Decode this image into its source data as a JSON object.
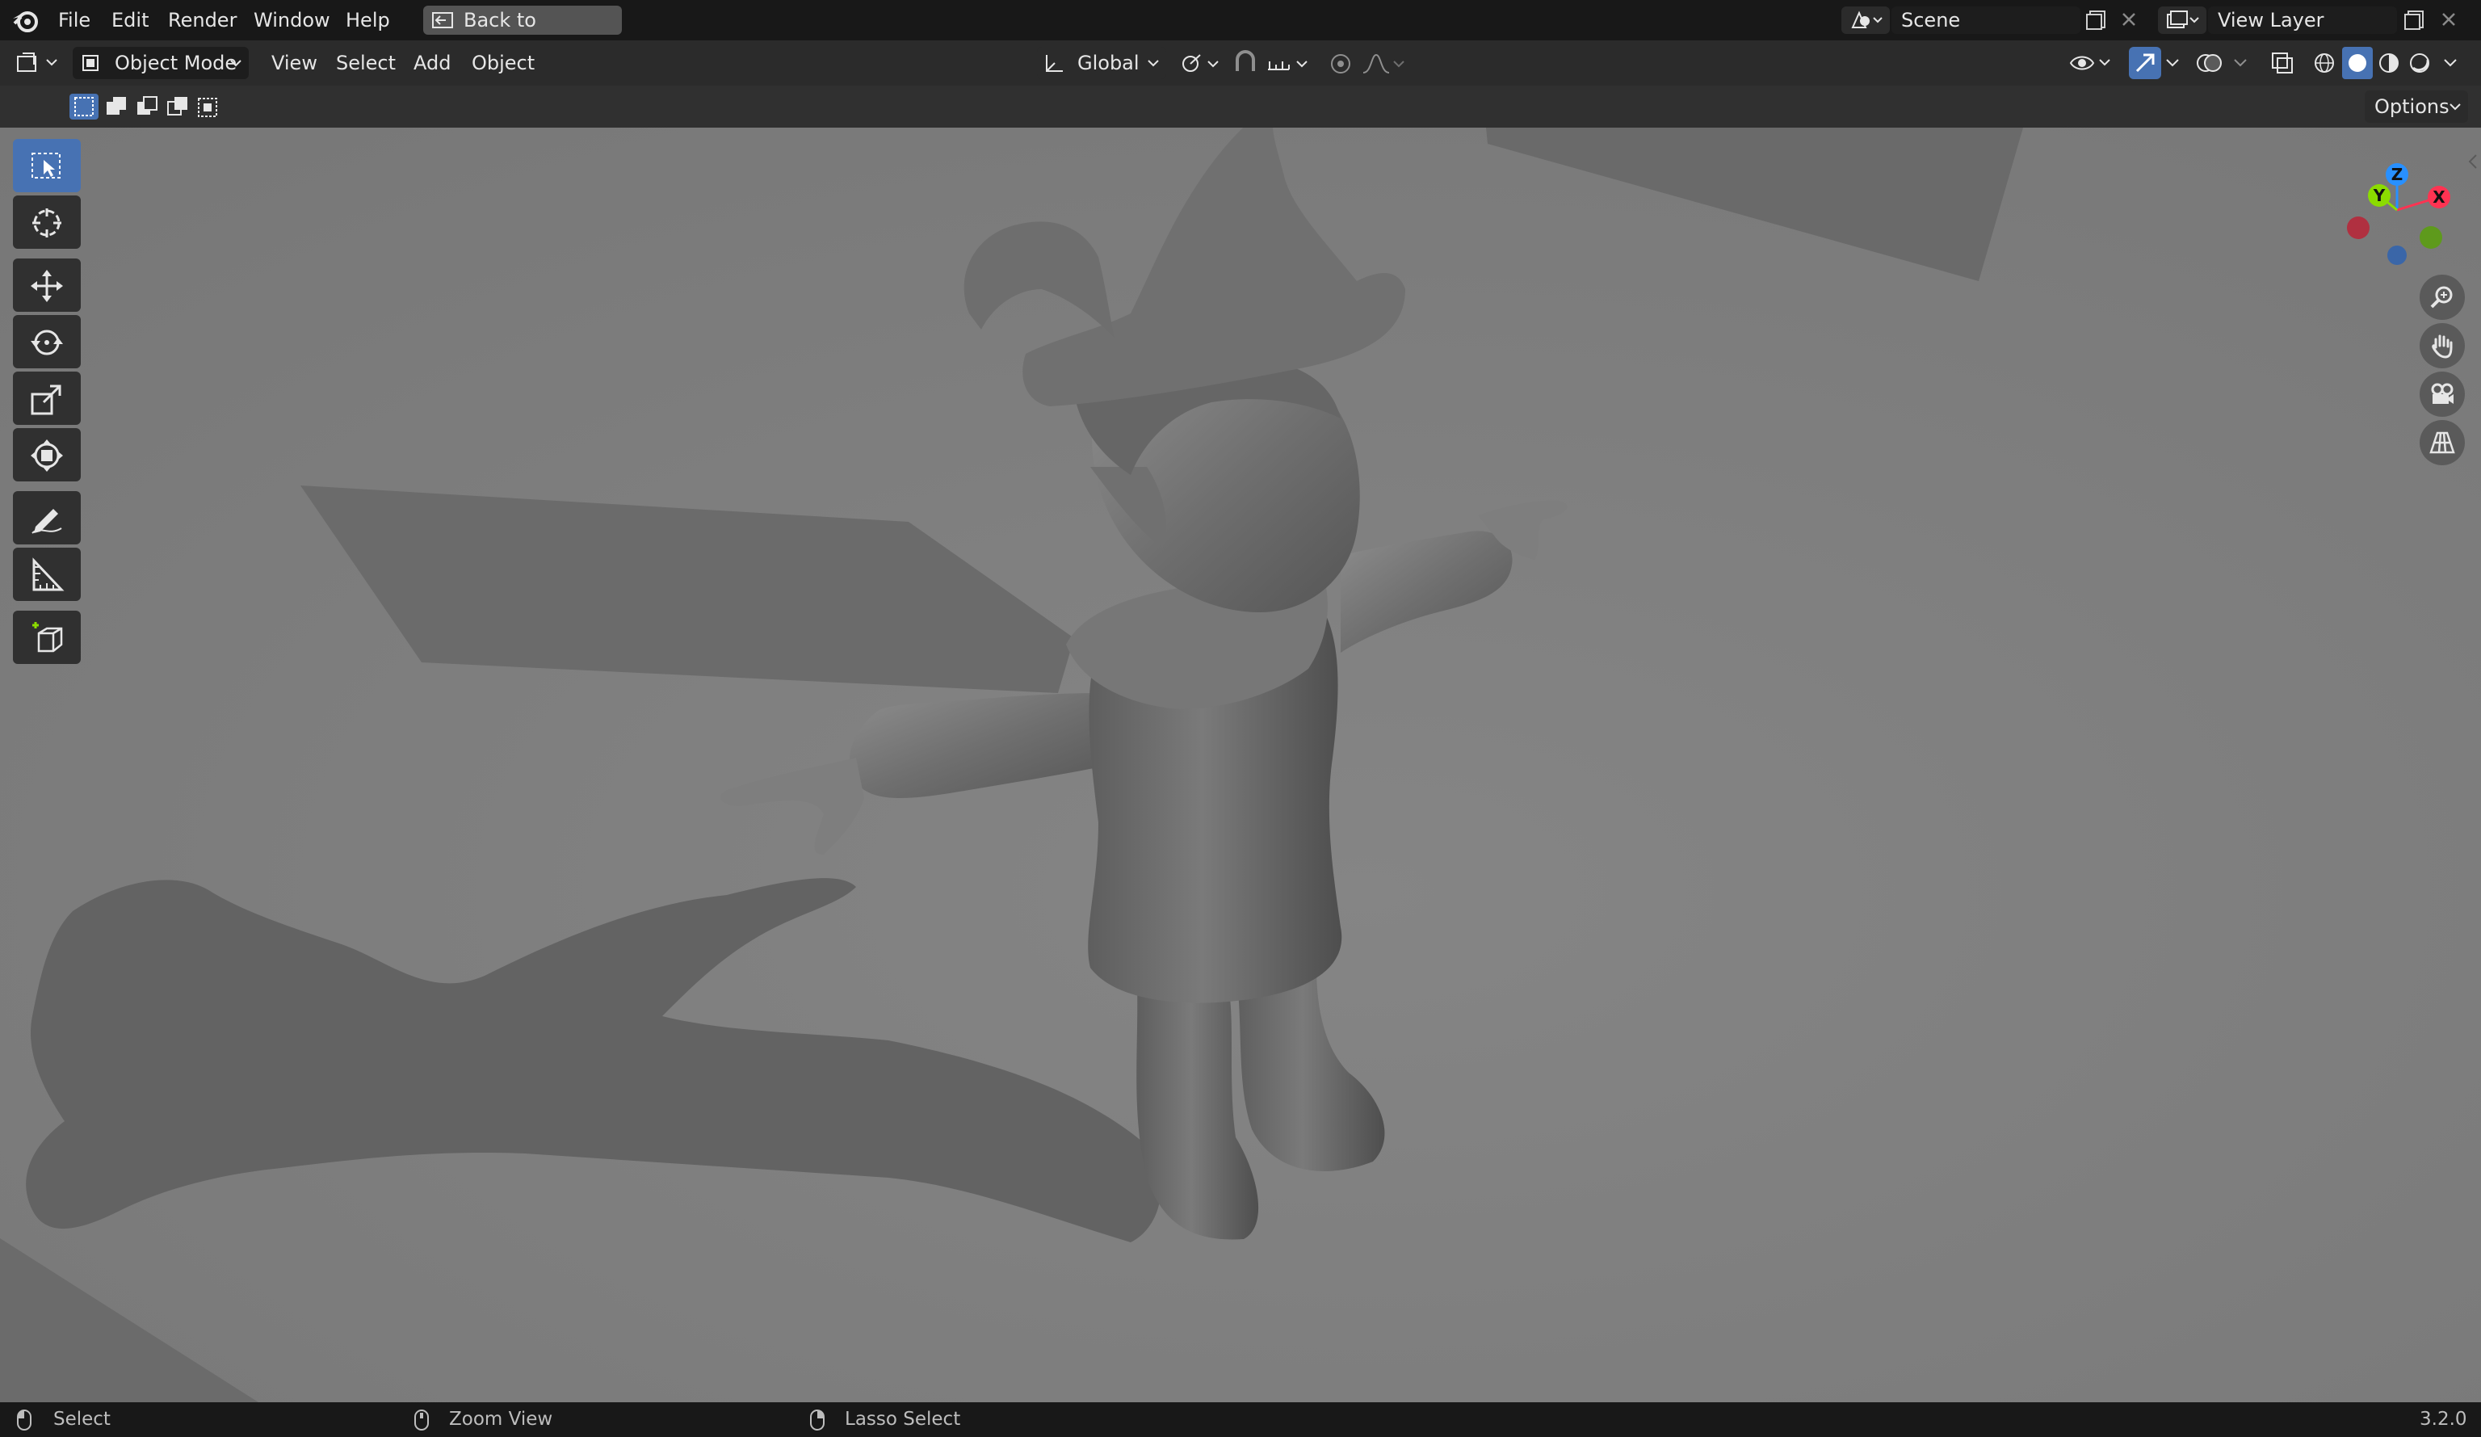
{
  "topbar": {
    "menu": [
      "File",
      "Edit",
      "Render",
      "Window",
      "Help"
    ],
    "back_button": "Back to Previous",
    "scene_name": "Scene",
    "view_layer": "View Layer"
  },
  "header": {
    "mode": "Object Mode",
    "menu": [
      "View",
      "Select",
      "Add",
      "Object"
    ],
    "orientation": "Global"
  },
  "toolrow": {
    "options_label": "Options"
  },
  "tools": [
    "select-box-tool",
    "cursor-tool",
    "move-tool",
    "rotate-tool",
    "scale-tool",
    "transform-tool",
    "annotate-tool",
    "measure-tool",
    "add-cube-tool"
  ],
  "gizmo": {
    "x_label": "X",
    "y_label": "Y",
    "z_label": "Z",
    "colors": {
      "x": "#ff3352",
      "y": "#8bdc00",
      "z": "#2890ff"
    }
  },
  "statusbar": {
    "left_click": "Select",
    "middle_click": "Zoom View",
    "right_click": "Lasso Select",
    "version": "3.2.0"
  },
  "accent": "#4772b3"
}
